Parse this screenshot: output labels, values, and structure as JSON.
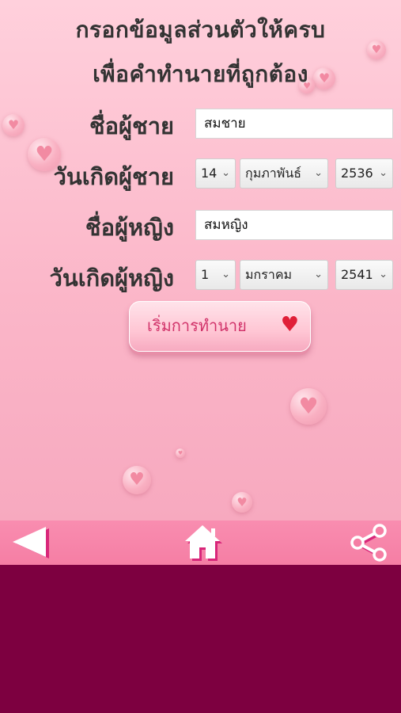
{
  "header": {
    "line1": "กรอกข้อมูลส่วนตัวให้ครบ",
    "line2": "เพื่อคำทำนายที่ถูกต้อง"
  },
  "male": {
    "name_label": "ชื่อผู้ชาย",
    "name_value": "สมชาย",
    "birth_label": "วันเกิดผู้ชาย",
    "day": "14",
    "month": "กุมภาพันธ์",
    "year": "2536"
  },
  "female": {
    "name_label": "ชื่อผู้หญิง",
    "name_value": "สมหญิง",
    "birth_label": "วันเกิดผู้หญิง",
    "day": "1",
    "month": "มกราคม",
    "year": "2541"
  },
  "start_button": {
    "label": "เริ่มการทำนาย"
  },
  "colors": {
    "background_bottom": "#7d0040",
    "nav_bar": "#f78cb0",
    "button_text": "#d1336a"
  },
  "icons": {
    "back": "back-arrow-icon",
    "home": "home-icon",
    "share": "share-icon"
  }
}
